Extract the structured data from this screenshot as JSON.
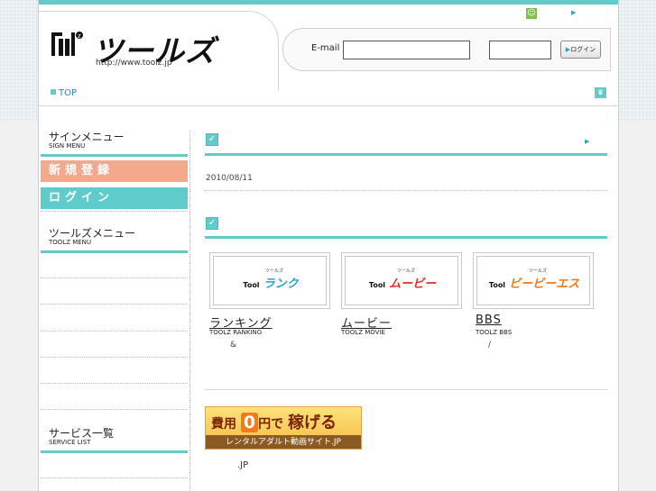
{
  "header": {
    "logo_text": "ツールズ",
    "logo_mark": "Tool",
    "logo_url": "http://www.toolz.jp",
    "email_label": "E-mail",
    "email_value": "",
    "password_value": "",
    "login_button_label": "ログイン"
  },
  "nav": {
    "top_link_label": "TOP"
  },
  "sidebar": {
    "sign_menu": {
      "title": "サインメニュー",
      "subtitle": "SIGN MENU"
    },
    "signup_label": "新規登録",
    "login_label": "ログイン",
    "toolz_menu": {
      "title": "ツールズメニュー",
      "subtitle": "TOOLZ MENU"
    },
    "service_list": {
      "title": "サービス一覧",
      "subtitle": "SERVICE LIST"
    }
  },
  "news": {
    "date": "2010/08/11"
  },
  "services": [
    {
      "brand": "ランク",
      "brand_sub": "ツールズ",
      "name": "ランキング",
      "en": "TOOLZ RANKING",
      "desc": "&",
      "color": "#2aa7c9"
    },
    {
      "brand": "ムービー",
      "brand_sub": "ツールズ",
      "name": "ムービー",
      "en": "TOOLZ MOVIE",
      "desc": "",
      "color": "#e0302a"
    },
    {
      "brand": "ビービーエス",
      "brand_sub": "ツールズ",
      "name": "BBS",
      "en": "TOOLZ BBS",
      "desc": "/",
      "color": "#f07a1a"
    }
  ],
  "banner": {
    "line1_pre": "費用",
    "line1_big": "0",
    "line1_mid": "円で",
    "line1_post": "稼げる",
    "line2": "レンタルアダルト動画サイト.JP",
    "caption": ".JP"
  },
  "colors": {
    "accent": "#66c9c9",
    "signup": "#f5a98c",
    "login": "#5fcbcb"
  }
}
